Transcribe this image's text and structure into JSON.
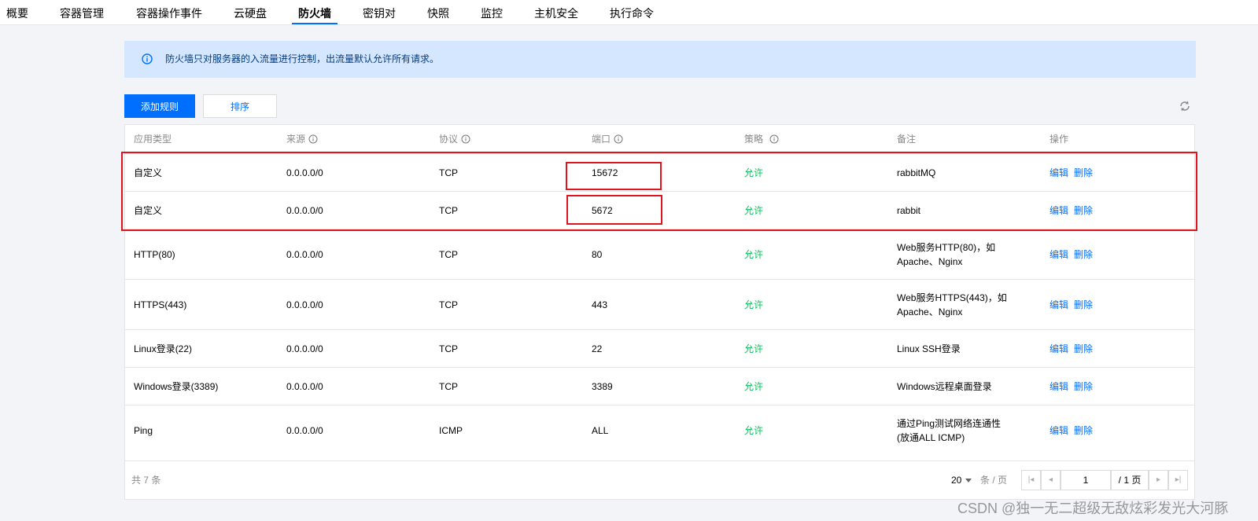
{
  "nav": {
    "tabs": [
      {
        "label": "概要"
      },
      {
        "label": "容器管理"
      },
      {
        "label": "容器操作事件"
      },
      {
        "label": "云硬盘"
      },
      {
        "label": "防火墙",
        "active": true
      },
      {
        "label": "密钥对"
      },
      {
        "label": "快照"
      },
      {
        "label": "监控"
      },
      {
        "label": "主机安全"
      },
      {
        "label": "执行命令"
      }
    ]
  },
  "notice": {
    "text": "防火墙只对服务器的入流量进行控制，出流量默认允许所有请求。",
    "icon": "info-circle-icon"
  },
  "toolbar": {
    "add_rule_label": "添加规则",
    "sort_label": "排序",
    "refresh_icon": "refresh-icon"
  },
  "table": {
    "columns": [
      "应用类型",
      "来源",
      "协议",
      "端口",
      "策略",
      "备注",
      "操作"
    ],
    "rows": [
      {
        "app": "自定义",
        "source": "0.0.0.0/0",
        "protocol": "TCP",
        "port": "15672",
        "policy": "允许",
        "note": "rabbitMQ",
        "edit": "编辑",
        "delete": "删除"
      },
      {
        "app": "自定义",
        "source": "0.0.0.0/0",
        "protocol": "TCP",
        "port": "5672",
        "policy": "允许",
        "note": "rabbit",
        "edit": "编辑",
        "delete": "删除"
      },
      {
        "app": "HTTP(80)",
        "source": "0.0.0.0/0",
        "protocol": "TCP",
        "port": "80",
        "policy": "允许",
        "note": "Web服务HTTP(80)，如Apache、Nginx",
        "edit": "编辑",
        "delete": "删除"
      },
      {
        "app": "HTTPS(443)",
        "source": "0.0.0.0/0",
        "protocol": "TCP",
        "port": "443",
        "policy": "允许",
        "note": "Web服务HTTPS(443)，如Apache、Nginx",
        "edit": "编辑",
        "delete": "删除"
      },
      {
        "app": "Linux登录(22)",
        "source": "0.0.0.0/0",
        "protocol": "TCP",
        "port": "22",
        "policy": "允许",
        "note": "Linux SSH登录",
        "edit": "编辑",
        "delete": "删除"
      },
      {
        "app": "Windows登录(3389)",
        "source": "0.0.0.0/0",
        "protocol": "TCP",
        "port": "3389",
        "policy": "允许",
        "note": "Windows远程桌面登录",
        "edit": "编辑",
        "delete": "删除"
      },
      {
        "app": "Ping",
        "source": "0.0.0.0/0",
        "protocol": "ICMP",
        "port": "ALL",
        "policy": "允许",
        "note": "通过Ping测试网络连通性(放通ALL ICMP)",
        "edit": "编辑",
        "delete": "删除"
      }
    ]
  },
  "pagination": {
    "total_text": "共 7 条",
    "page_size": "20",
    "per_page_label": "条 / 页",
    "current_page": "1",
    "total_pages_text": "/ 1 页"
  },
  "watermark": "CSDN @独一无二超级无敌炫彩发光大河豚",
  "colors": {
    "accent": "#006eff",
    "allow": "#0abf5b",
    "notice_bg": "#d5e7ff",
    "highlight": "#e0141e"
  }
}
